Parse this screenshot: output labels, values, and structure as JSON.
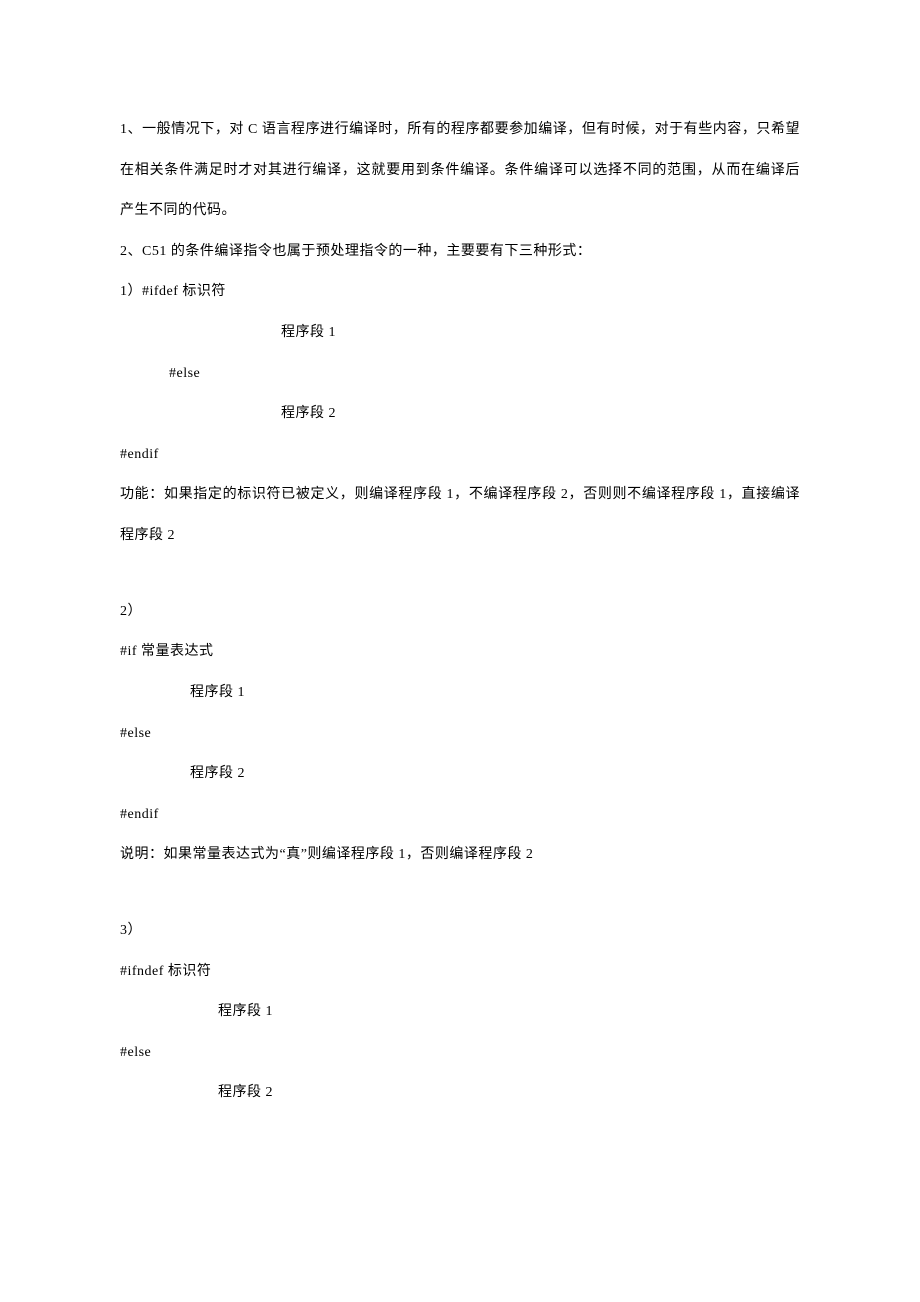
{
  "paragraphs": {
    "p1": "1、一般情况下，对 C 语言程序进行编译时，所有的程序都要参加编译，但有时候，对于有些内容，只希望在相关条件满足时才对其进行编译，这就要用到条件编译。条件编译可以选择不同的范围，从而在编译后产生不同的代码。",
    "p2": "2、C51 的条件编译指令也属于预处理指令的一种，主要要有下三种形式：",
    "p3": "1）#ifdef 标识符",
    "p4": "程序段 1",
    "p5": "#else",
    "p6": "程序段 2",
    "p7": "#endif",
    "p8": "功能：如果指定的标识符已被定义，则编译程序段 1，不编译程序段 2，否则则不编译程序段 1，直接编译程序段 2",
    "p9": "2）",
    "p10": "#if 常量表达式",
    "p11": "程序段 1",
    "p12": "#else",
    "p13": "程序段 2",
    "p14": "#endif",
    "p15": "说明：如果常量表达式为“真”则编译程序段 1，否则编译程序段 2",
    "p16": "3）",
    "p17": "#ifndef 标识符",
    "p18": "程序段 1",
    "p19": "#else",
    "p20": "程序段 2"
  }
}
